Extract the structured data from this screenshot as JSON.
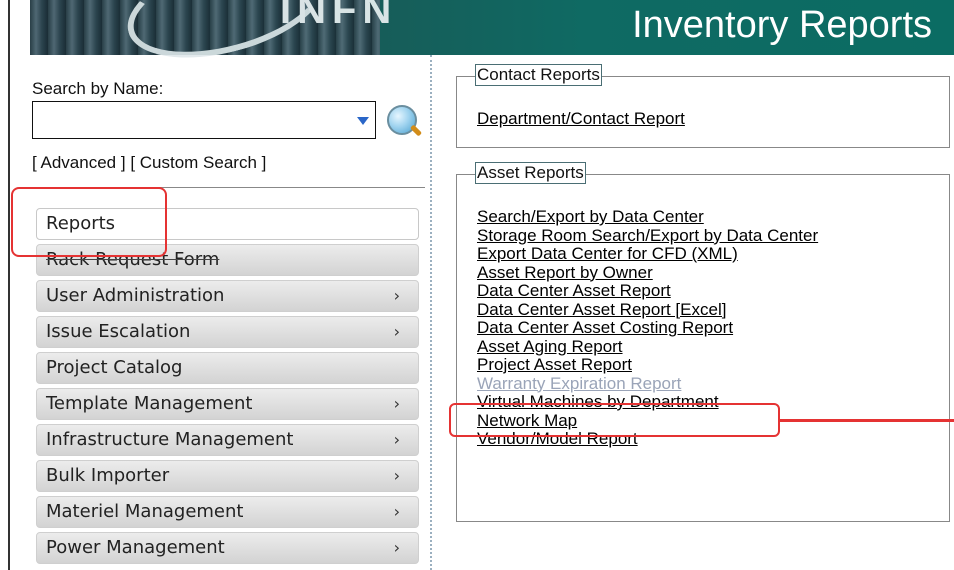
{
  "header": {
    "page_title": "Inventory Reports",
    "logo_text": "INFN"
  },
  "sidebar": {
    "search_label": "Search by Name:",
    "search_value": "",
    "advanced_link": "[ Advanced ]",
    "custom_search_link": "[ Custom Search ]",
    "menu": [
      {
        "label": "Reports",
        "chevron": ""
      },
      {
        "label": "Rack Request Form",
        "chevron": ""
      },
      {
        "label": "User Administration",
        "chevron": "›"
      },
      {
        "label": "Issue Escalation",
        "chevron": "›"
      },
      {
        "label": "Project Catalog",
        "chevron": ""
      },
      {
        "label": "Template Management",
        "chevron": "›"
      },
      {
        "label": "Infrastructure Management",
        "chevron": "›"
      },
      {
        "label": "Bulk Importer",
        "chevron": "›"
      },
      {
        "label": "Materiel Management",
        "chevron": "›"
      },
      {
        "label": "Power Management",
        "chevron": "›"
      }
    ]
  },
  "contact_reports": {
    "title": "Contact Reports",
    "links": [
      "Department/Contact Report"
    ]
  },
  "asset_reports": {
    "title": "Asset Reports",
    "links": [
      "Search/Export by Data Center",
      "Storage Room Search/Export by Data Center",
      "Export Data Center for CFD (XML)",
      "Asset Report by Owner",
      "Data Center Asset Report",
      "Data Center Asset Report [Excel]",
      "Data Center Asset Costing Report",
      "Asset Aging Report",
      "Project Asset Report",
      "Warranty Expiration Report",
      "Virtual Machines by Department",
      "Network Map",
      "Vendor/Model Report"
    ]
  },
  "colors": {
    "header_bg": "#0b6c63",
    "annotation_red": "#e53333",
    "visited_link": "#9aa4b8"
  }
}
